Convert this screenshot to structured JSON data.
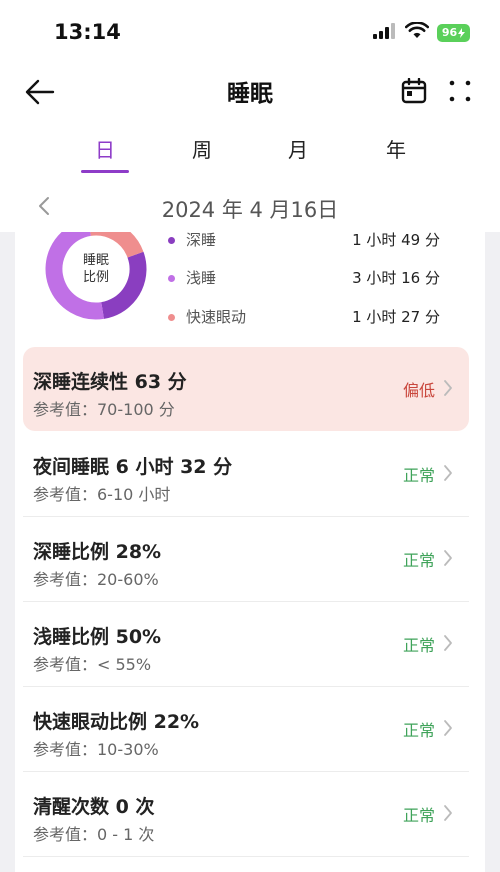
{
  "status_bar": {
    "time": "13:14",
    "battery": "96"
  },
  "header": {
    "title": "睡眠"
  },
  "tabs": [
    {
      "label": "日",
      "active": true
    },
    {
      "label": "周",
      "active": false
    },
    {
      "label": "月",
      "active": false
    },
    {
      "label": "年",
      "active": false
    }
  ],
  "date": {
    "text": "2024 年 4 月16日"
  },
  "donut": {
    "center_line1": "睡眠",
    "center_line2": "比例"
  },
  "legend": [
    {
      "label": "深睡",
      "value": "1 小时 49 分",
      "color": "#8a3ec0"
    },
    {
      "label": "浅睡",
      "value": "3 小时 16 分",
      "color": "#c070e6"
    },
    {
      "label": "快速眼动",
      "value": "1 小时 27 分",
      "color": "#ef8e8e"
    }
  ],
  "sleep_ratio": {
    "deep": 0.28,
    "light": 0.5,
    "rem": 0.22
  },
  "metrics": [
    {
      "title": "深睡连续性 63 分",
      "reference": "参考值：70-100 分",
      "status": "偏低",
      "status_color": "#c9463c",
      "highlight": true
    },
    {
      "title": "夜间睡眠 6 小时 32 分",
      "reference": "参考值：6-10 小时",
      "status": "正常",
      "status_color": "#3fa35a",
      "highlight": false
    },
    {
      "title": "深睡比例 28%",
      "reference": "参考值：20-60%",
      "status": "正常",
      "status_color": "#3fa35a",
      "highlight": false
    },
    {
      "title": "浅睡比例 50%",
      "reference": "参考值：< 55%",
      "status": "正常",
      "status_color": "#3fa35a",
      "highlight": false
    },
    {
      "title": "快速眼动比例 22%",
      "reference": "参考值：10-30%",
      "status": "正常",
      "status_color": "#3fa35a",
      "highlight": false
    },
    {
      "title": "清醒次数 0 次",
      "reference": "参考值：0 - 1 次",
      "status": "正常",
      "status_color": "#3fa35a",
      "highlight": false
    }
  ]
}
